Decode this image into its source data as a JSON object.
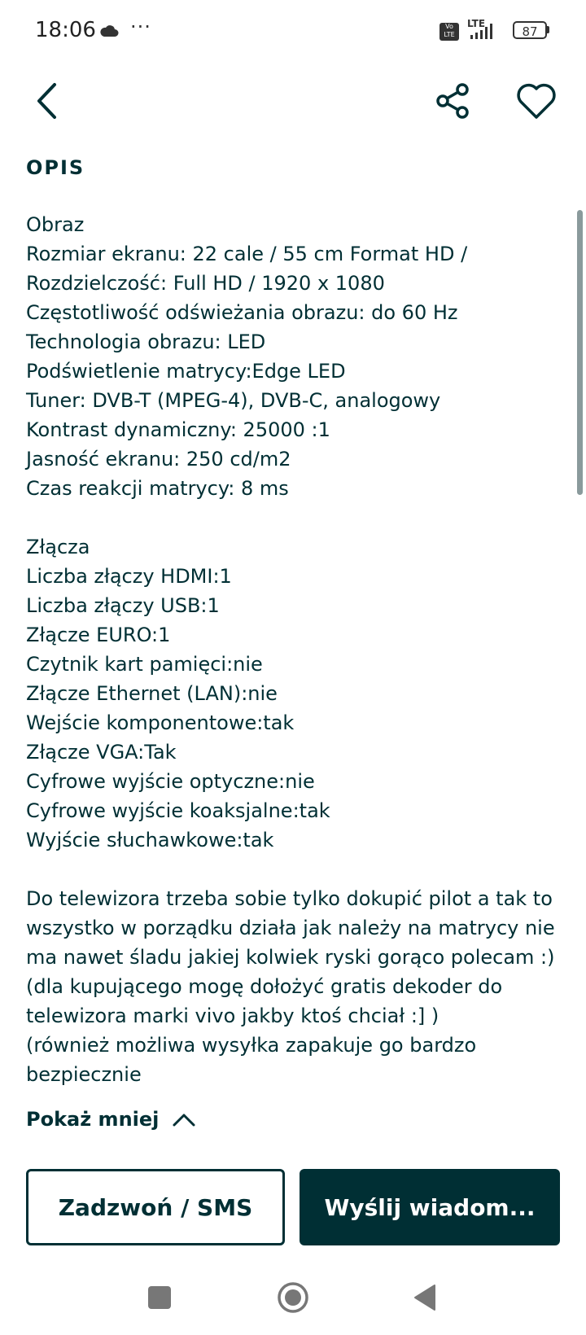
{
  "status_bar": {
    "time": "18:06",
    "dots": "···",
    "network": "LTE",
    "volte": "Vo LTE",
    "battery": "87"
  },
  "header": {
    "back_icon": "chevron-left-icon",
    "share_icon": "share-icon",
    "favorite_icon": "heart-icon"
  },
  "section": {
    "title": "OPIS"
  },
  "description": {
    "lines": [
      "Obraz",
      "Rozmiar ekranu: 22 cale / 55 cm Format HD /",
      "Rozdzielczość: Full HD / 1920 x 1080",
      "Częstotliwość odświeżania obrazu: do 60 Hz",
      "Technologia obrazu: LED",
      "Podświetlenie matrycy:Edge LED",
      "Tuner: DVB-T (MPEG-4), DVB-C, analogowy",
      "Kontrast dynamiczny: 25000 :1",
      "Jasność ekranu: 250 cd/m2",
      "Czas reakcji matrycy: 8 ms",
      "",
      "Złącza",
      "Liczba złączy HDMI:1",
      "Liczba złączy USB:1",
      "Złącze EURO:1",
      "Czytnik kart pamięci:nie",
      "Złącze Ethernet (LAN):nie",
      "Wejście komponentowe:tak",
      "Złącze VGA:Tak",
      "Cyfrowe wyjście optyczne:nie",
      "Cyfrowe wyjście koaksjalne:tak",
      "Wyjście słuchawkowe:tak",
      "",
      "Do telewizora trzeba sobie tylko dokupić pilot a tak to",
      "wszystko w porządku działa jak należy na matrycy nie",
      "ma nawet śladu jakiej kolwiek ryski gorąco polecam :)",
      "(dla kupującego mogę dołożyć gratis dekoder do",
      "telewizora marki vivo jakby ktoś chciał :] )",
      "(również możliwa wysyłka zapakuje go bardzo",
      "bezpiecznie"
    ]
  },
  "show_less": {
    "label": "Pokaż mniej",
    "icon": "chevron-up-icon"
  },
  "actions": {
    "call_label": "Zadzwoń / SMS",
    "message_label": "Wyślij wiadom..."
  },
  "colors": {
    "primary": "#002f34",
    "background": "#ffffff"
  }
}
